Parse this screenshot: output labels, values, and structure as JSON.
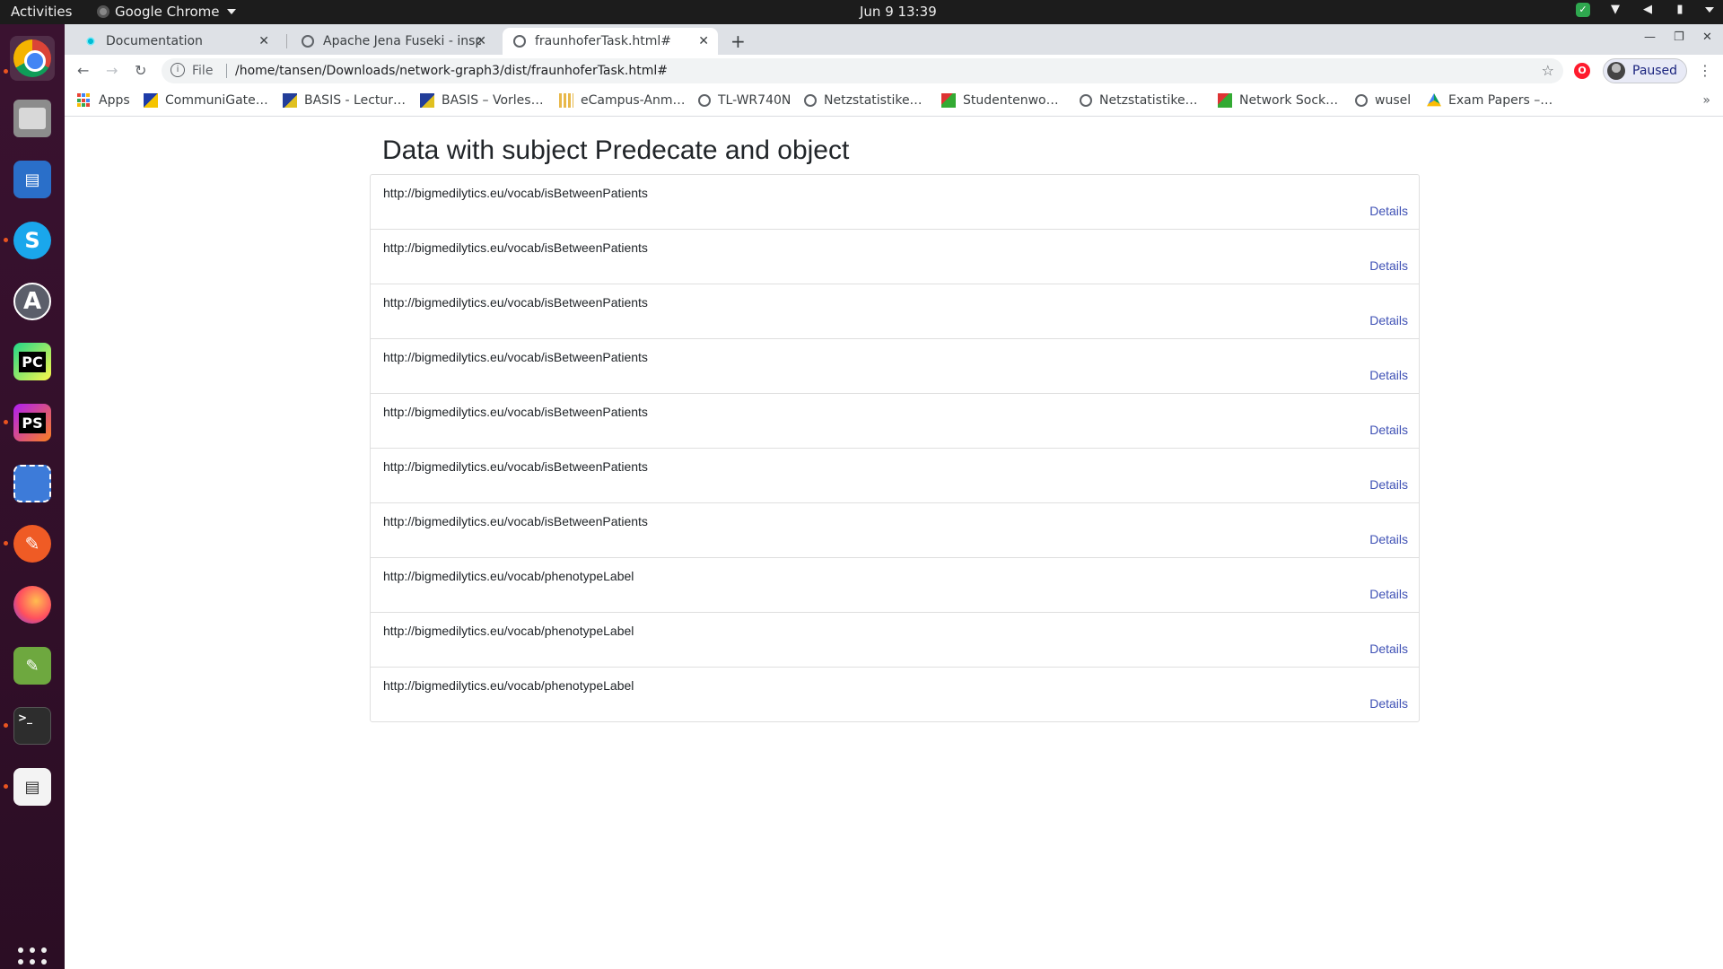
{
  "system_bar": {
    "activities": "Activities",
    "app_name": "Google Chrome",
    "clock": "Jun 9  13:39"
  },
  "browser": {
    "tabs": [
      {
        "title": "Documentation",
        "favicon": "docs-icon"
      },
      {
        "title": "Apache Jena Fuseki - insp",
        "favicon": "globe-icon"
      },
      {
        "title": "fraunhoferTask.html#",
        "favicon": "globe-icon",
        "active": true
      }
    ],
    "address": {
      "scheme": "File",
      "url": "/home/tansen/Downloads/network-graph3/dist/fraunhoferTask.html#"
    },
    "profile_status": "Paused",
    "bookmarks": [
      {
        "label": "Apps",
        "icon": "apps-grid-icon"
      },
      {
        "label": "CommuniGate…",
        "icon": "communigate-icon"
      },
      {
        "label": "BASIS - Lectur…",
        "icon": "basis-icon"
      },
      {
        "label": "BASIS – Vorles…",
        "icon": "basis-icon"
      },
      {
        "label": "eCampus-Anm…",
        "icon": "ecampus-icon"
      },
      {
        "label": "TL-WR740N",
        "icon": "globe-icon"
      },
      {
        "label": "Netzstatistike…",
        "icon": "globe-icon"
      },
      {
        "label": "Studentenwo…",
        "icon": "studentenwerk-icon"
      },
      {
        "label": "Netzstatistike…",
        "icon": "globe-icon"
      },
      {
        "label": "Network Sock…",
        "icon": "studentenwerk-icon"
      },
      {
        "label": "wusel",
        "icon": "globe-icon"
      },
      {
        "label": "Exam Papers –…",
        "icon": "google-drive-icon"
      }
    ]
  },
  "page": {
    "title": "Data with subject Predecate and object",
    "details_label": "Details",
    "rows": [
      {
        "uri": "http://bigmedilytics.eu/vocab/isBetweenPatients"
      },
      {
        "uri": "http://bigmedilytics.eu/vocab/isBetweenPatients"
      },
      {
        "uri": "http://bigmedilytics.eu/vocab/isBetweenPatients"
      },
      {
        "uri": "http://bigmedilytics.eu/vocab/isBetweenPatients"
      },
      {
        "uri": "http://bigmedilytics.eu/vocab/isBetweenPatients"
      },
      {
        "uri": "http://bigmedilytics.eu/vocab/isBetweenPatients"
      },
      {
        "uri": "http://bigmedilytics.eu/vocab/isBetweenPatients"
      },
      {
        "uri": "http://bigmedilytics.eu/vocab/phenotypeLabel"
      },
      {
        "uri": "http://bigmedilytics.eu/vocab/phenotypeLabel"
      },
      {
        "uri": "http://bigmedilytics.eu/vocab/phenotypeLabel"
      }
    ]
  },
  "colors": {
    "link": "#3f51b5",
    "dock": "#2c0f22",
    "accent_dot": "#e95420"
  }
}
